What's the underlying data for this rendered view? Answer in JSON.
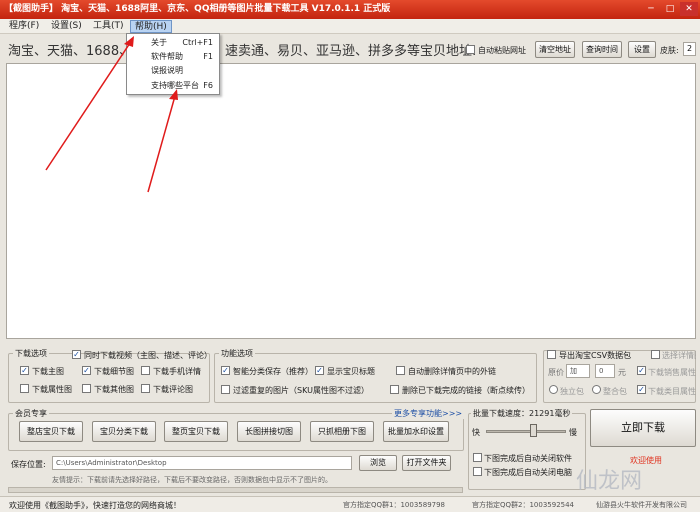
{
  "window": {
    "title": "【截图助手】 淘宝、天猫、1688阿里、京东、QQ相册等图片批量下载工具 V17.0.1.1 正式版",
    "min": "─",
    "max": "□",
    "close": "✕"
  },
  "menu": {
    "program": "程序(F)",
    "settings": "设置(S)",
    "tools": "工具(T)",
    "help": "帮助(H)"
  },
  "help_menu": [
    {
      "label": "关于",
      "shortcut": "Ctrl+F1"
    },
    {
      "label": "软件帮助",
      "shortcut": "F1"
    },
    {
      "label": "误报说明",
      "shortcut": ""
    },
    {
      "label": "支持哪些平台",
      "shortcut": "F6"
    }
  ],
  "url_row": {
    "prompt_left": "淘宝、天猫、1688、",
    "prompt_right": "速卖通、易贝、亚马逊、拼多多等宝贝地址:",
    "auto_paste": "自动粘贴网址",
    "clear_btn": "清空地址",
    "query_btn": "查询时间",
    "settings_btn": "设置",
    "threads_label": "皮肤:",
    "threads_value": "2"
  },
  "download_options": {
    "title": "下载选项",
    "video": "同时下载视频（主图、描述、评论）",
    "items": [
      "下载主图",
      "下载细节图",
      "下载手机详情",
      "下载属性图",
      "下载其他图",
      "下载评论图"
    ],
    "checked": [
      true,
      true,
      false,
      false,
      false,
      false
    ]
  },
  "func_options": {
    "title": "功能选项",
    "items": [
      "智能分类保存（推荐）",
      "显示宝贝标题",
      "自动删除详情页中的外链",
      "过滤重复的图片（SKU属性图不过滤）",
      "删除已下载完成的链接（断点续传）"
    ],
    "checked": [
      true,
      true,
      false,
      false,
      false
    ]
  },
  "csv": {
    "export": "导出淘宝CSV数据包",
    "original_price": "原价",
    "op": "加",
    "amount": "0",
    "unit": "元",
    "radio1": "独立包",
    "radio2": "整合包",
    "right1": "选择详情图",
    "right2": "下载销售属性",
    "right3": "下载类目属性"
  },
  "vip": {
    "title": "会员专享",
    "more": "更多专享功能>>>",
    "buttons": [
      "整店宝贝下载",
      "宝贝分类下载",
      "整页宝贝下载",
      "长图拼接切图",
      "只抓相册下图",
      "批量加水印设置"
    ]
  },
  "speed": {
    "label": "批量下载速度：",
    "value": "21291毫秒",
    "fast": "快",
    "slow": "慢",
    "close_software": "下图完成后自动关闭软件",
    "shutdown": "下图完成后自动关闭电脑"
  },
  "save": {
    "label": "保存位置:",
    "path": "C:\\Users\\Administrator\\Desktop",
    "browse": "浏览",
    "open_folder": "打开文件夹",
    "hint": "友情提示：下载前请先选择好路径，下载后不要改变路径，否则数据包中显示不了图片的。"
  },
  "download_now": "立即下载",
  "welcome_use": "欢迎使用",
  "status": {
    "left": "欢迎使用《截图助手》，快速打造您的网络商城！",
    "qq1": "官方指定QQ群1：1003589798",
    "qq2": "官方指定QQ群2：1003592544",
    "company": "仙游县火牛软件开发有限公司"
  },
  "watermark": "仙龙网"
}
